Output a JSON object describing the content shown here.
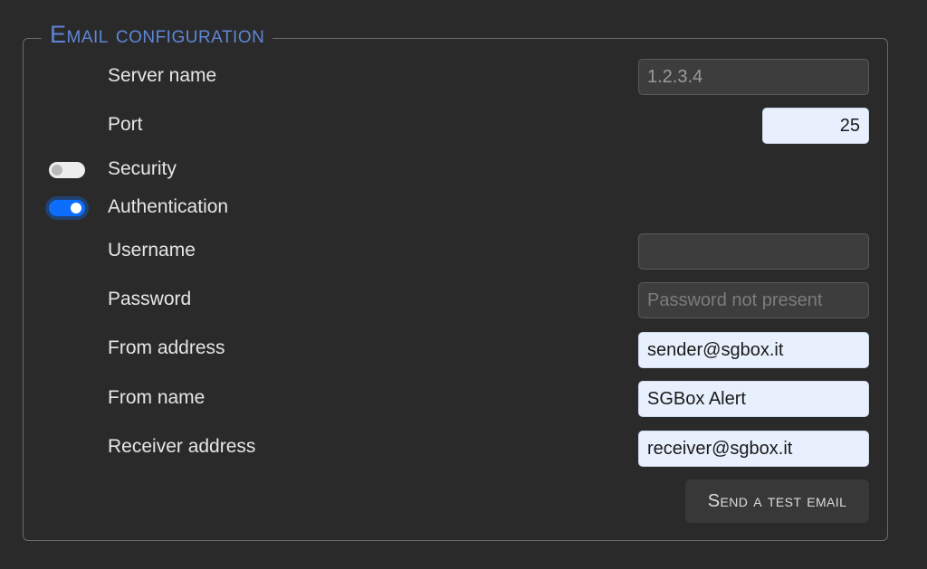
{
  "section": {
    "legend": "Email configuration"
  },
  "fields": {
    "server_name": {
      "label": "Server name",
      "value": "1.2.3.4"
    },
    "port": {
      "label": "Port",
      "value": "25"
    },
    "security": {
      "label": "Security",
      "enabled": false
    },
    "authentication": {
      "label": "Authentication",
      "enabled": true
    },
    "username": {
      "label": "Username",
      "value": ""
    },
    "password": {
      "label": "Password",
      "value": "",
      "placeholder": "Password not present"
    },
    "from_address": {
      "label": "From address",
      "value": "sender@sgbox.it"
    },
    "from_name": {
      "label": "From name",
      "value": "SGBox Alert"
    },
    "receiver_address": {
      "label": "Receiver address",
      "value": "receiver@sgbox.it"
    }
  },
  "actions": {
    "send_test_label": "Send a test email"
  },
  "colors": {
    "background": "#2a2a2a",
    "legend": "#5f86d6",
    "toggle_on": "#0d6efd",
    "input_filled": "#e8f0fe",
    "input_disabled": "#3d3d3d"
  }
}
